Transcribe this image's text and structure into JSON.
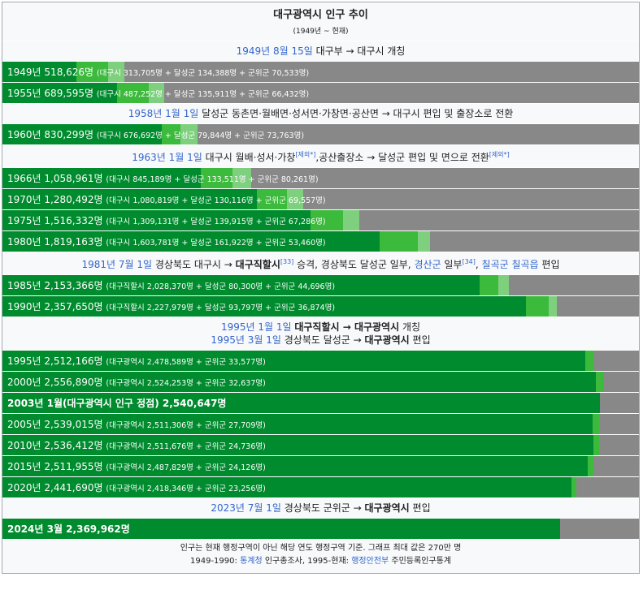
{
  "title": "대구광역시 인구 추이",
  "subtitle": "(1949년 ~ 현재)",
  "colors": {
    "core": "#008B2E",
    "mid": "#3CBA3C",
    "light": "#7ED07E",
    "remainder": "#888888"
  },
  "chart_data": {
    "type": "bar",
    "max_value": 2700000,
    "rows": [
      {
        "kind": "header",
        "lines": [
          {
            "link": "1949년 8월 15일",
            "text": " 대구부 → 대구시 개칭"
          }
        ]
      },
      {
        "kind": "bar",
        "year": "1949년",
        "total": 518626,
        "total_text": "518,626명",
        "detail": "(대구시 313,705명 + 달성군 134,388명 + 군위군 70,533명)",
        "values": [
          313705,
          134388,
          70533
        ]
      },
      {
        "kind": "bar",
        "year": "1955년",
        "total": 689595,
        "total_text": "689,595명",
        "detail": "(대구시 487,252명 + 달성군 135,911명 + 군위군 66,432명)",
        "values": [
          487252,
          135911,
          66432
        ]
      },
      {
        "kind": "header",
        "lines": [
          {
            "link": "1958년 1월 1일",
            "text": " 달성군 동촌면·월배면·성서면·가창면·공산면 → 대구시 편입 및 출장소로 전환"
          }
        ]
      },
      {
        "kind": "bar",
        "year": "1960년",
        "total": 830299,
        "total_text": "830,299명",
        "detail": "(대구시 676,692명 + 달성군 79,844명 + 군위군 73,763명)",
        "values": [
          676692,
          79844,
          73763
        ]
      },
      {
        "kind": "header",
        "lines": [
          {
            "link": "1963년 1월 1일",
            "text": " 대구시 월배·성서·가창",
            "sup1": "[제외*]",
            "text2": ",공산출장소",
            "sup2": "[제외*]",
            "text3": " → 달성군 편입 및 면으로 전환"
          }
        ]
      },
      {
        "kind": "bar",
        "year": "1966년",
        "total": 1058961,
        "total_text": "1,058,961명",
        "detail": "(대구시 845,189명 + 달성군 133,511명 + 군위군 80,261명)",
        "values": [
          845189,
          133511,
          80261
        ]
      },
      {
        "kind": "bar",
        "year": "1970년",
        "total": 1280492,
        "total_text": "1,280,492명",
        "detail": "(대구시 1,080,819명 + 달성군 130,116명 + 군위군 69,557명)",
        "values": [
          1080819,
          130116,
          69557
        ]
      },
      {
        "kind": "bar",
        "year": "1975년",
        "total": 1516332,
        "total_text": "1,516,332명",
        "detail": "(대구시 1,309,131명 + 달성군 139,915명 + 군위군 67,286명)",
        "values": [
          1309131,
          139915,
          67286
        ]
      },
      {
        "kind": "bar",
        "year": "1980년",
        "total": 1819163,
        "total_text": "1,819,163명",
        "detail": "(대구시 1,603,781명 + 달성군 161,922명 + 군위군 53,460명)",
        "values": [
          1603781,
          161922,
          53460
        ]
      },
      {
        "kind": "header",
        "lines": [
          {
            "link": "1981년 7월 1일",
            "text": " 경상북도 대구시 → ",
            "bold": "대구직할시",
            "text2": " 승격, 경상북도 달성군 일부",
            "sup1": "[33]",
            "text3": ", ",
            "link2": "경산군",
            "text4": " 일부",
            "sup2": "[34]",
            "text5": ", ",
            "link3": "칠곡군 칠곡읍",
            "text6": " 편입"
          }
        ]
      },
      {
        "kind": "bar",
        "year": "1985년",
        "total": 2153366,
        "total_text": "2,153,366명",
        "detail": "(대구직할시 2,028,370명 + 달성군 80,300명 + 군위군 44,696명)",
        "values": [
          2028370,
          80300,
          44696
        ]
      },
      {
        "kind": "bar",
        "year": "1990년",
        "total": 2357650,
        "total_text": "2,357,650명",
        "detail": "(대구직할시 2,227,979명 + 달성군 93,797명 + 군위군 36,874명)",
        "values": [
          2227979,
          93797,
          36874
        ]
      },
      {
        "kind": "header",
        "lines": [
          {
            "link": "1995년 1월 1일",
            "text": " ",
            "bold": "대구직할시 → 대구광역시",
            "text2": " 개칭"
          },
          {
            "link": "1995년 3월 1일",
            "text": " 경상북도 달성군 → ",
            "bold": "대구광역시",
            "text2": " 편입"
          }
        ]
      },
      {
        "kind": "bar",
        "year": "1995년",
        "total": 2512166,
        "total_text": "2,512,166명",
        "detail": "(대구광역시 2,478,589명 + 군위군 33,577명)",
        "values": [
          2478589,
          33577
        ]
      },
      {
        "kind": "bar",
        "year": "2000년",
        "total": 2556890,
        "total_text": "2,556,890명",
        "detail": "(대구광역시 2,524,253명 + 군위군 32,637명)",
        "values": [
          2524253,
          32637
        ]
      },
      {
        "kind": "bar",
        "bold": true,
        "label": "2003년 1월(대구광역시 인구 정점) 2,540,647명",
        "total": 2540647,
        "values": [
          2540647
        ]
      },
      {
        "kind": "bar",
        "year": "2005년",
        "total": 2539015,
        "total_text": "2,539,015명",
        "detail": "(대구광역시 2,511,306명 + 군위군 27,709명)",
        "values": [
          2511306,
          27709
        ]
      },
      {
        "kind": "bar",
        "year": "2010년",
        "total": 2536412,
        "total_text": "2,536,412명",
        "detail": "(대구광역시 2,511,676명 + 군위군 24,736명)",
        "values": [
          2511676,
          24736
        ]
      },
      {
        "kind": "bar",
        "year": "2015년",
        "total": 2511955,
        "total_text": "2,511,955명",
        "detail": "(대구광역시 2,487,829명 + 군위군 24,126명)",
        "values": [
          2487829,
          24126
        ]
      },
      {
        "kind": "bar",
        "year": "2020년",
        "total": 2441690,
        "total_text": "2,441,690명",
        "detail": "(대구광역시 2,418,346명 + 군위군 23,256명)",
        "values": [
          2418346,
          23256
        ]
      },
      {
        "kind": "header",
        "lines": [
          {
            "link": "2023년 7월 1일",
            "text": " 경상북도 군위군 → ",
            "bold": "대구광역시",
            "text2": " 편입"
          }
        ]
      },
      {
        "kind": "bar",
        "bold": true,
        "label": "2024년 3월 2,369,962명",
        "total": 2369962,
        "values": [
          2369962
        ]
      }
    ]
  },
  "footer": {
    "line1": "인구는 현재 행정구역이 아닌 해당 연도 행정구역 기준. 그래프 최대 값은 270만 명",
    "line2_a": "1949-1990: ",
    "line2_link1": "통계청",
    "line2_b": " 인구총조사, 1995-현재: ",
    "line2_link2": "행정안전부",
    "line2_c": " 주민등록인구통계"
  }
}
